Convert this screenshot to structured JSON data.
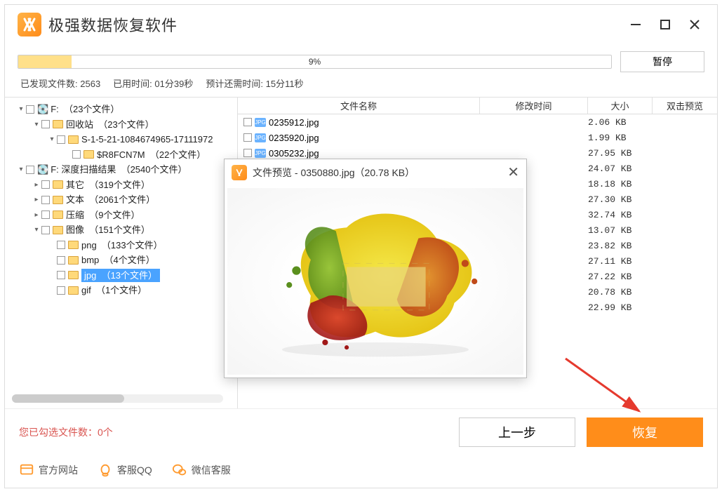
{
  "app_title": "极强数据恢复软件",
  "progress": {
    "percent_text": "9%",
    "percent": 9
  },
  "pause_label": "暂停",
  "status": {
    "found_label_prefix": "已发现文件数:",
    "found_value": "2563",
    "elapsed_label": "已用时间:",
    "elapsed_value": "01分39秒",
    "remaining_label": "预计还需时间:",
    "remaining_value": "15分11秒"
  },
  "tree": [
    {
      "indent": 0,
      "caret": "▾",
      "drive": true,
      "label": "F:",
      "count": "（23个文件）"
    },
    {
      "indent": 1,
      "caret": "▾",
      "drive": false,
      "label": "回收站",
      "count": "（23个文件）"
    },
    {
      "indent": 2,
      "caret": "▾",
      "drive": false,
      "label": "S-1-5-21-1084674965-17111972"
    },
    {
      "indent": 3,
      "caret": "",
      "drive": false,
      "label": "$R8FCN7M",
      "count": "（22个文件）"
    },
    {
      "indent": 0,
      "caret": "▾",
      "drive": true,
      "label": "F: 深度扫描结果",
      "count": "（2540个文件）"
    },
    {
      "indent": 1,
      "caret": "▸",
      "drive": false,
      "label": "其它",
      "count": "（319个文件）"
    },
    {
      "indent": 1,
      "caret": "▸",
      "drive": false,
      "label": "文本",
      "count": "（2061个文件）"
    },
    {
      "indent": 1,
      "caret": "▸",
      "drive": false,
      "label": "压缩",
      "count": "（9个文件）"
    },
    {
      "indent": 1,
      "caret": "▾",
      "drive": false,
      "label": "图像",
      "count": "（151个文件）"
    },
    {
      "indent": 2,
      "caret": "",
      "drive": false,
      "label": "png",
      "count": "（133个文件）"
    },
    {
      "indent": 2,
      "caret": "",
      "drive": false,
      "label": "bmp",
      "count": "（4个文件）"
    },
    {
      "indent": 2,
      "caret": "",
      "drive": false,
      "label": "jpg",
      "count": "（13个文件）",
      "selected": true
    },
    {
      "indent": 2,
      "caret": "",
      "drive": false,
      "label": "gif",
      "count": "（1个文件）"
    }
  ],
  "columns": {
    "name": "文件名称",
    "time": "修改时间",
    "size": "大小",
    "preview": "双击预览"
  },
  "files": [
    {
      "name": "0235912.jpg",
      "size": "2.06 KB",
      "visible": true
    },
    {
      "name": "0235920.jpg",
      "size": "1.99 KB",
      "visible": true
    },
    {
      "name": "0305232.jpg",
      "size": "27.95 KB",
      "visible": false
    },
    {
      "name": "",
      "size": "24.07 KB"
    },
    {
      "name": "",
      "size": "18.18 KB"
    },
    {
      "name": "",
      "size": "27.30 KB"
    },
    {
      "name": "",
      "size": "32.74 KB"
    },
    {
      "name": "",
      "size": "13.07 KB"
    },
    {
      "name": "",
      "size": "23.82 KB"
    },
    {
      "name": "",
      "size": "27.11 KB"
    },
    {
      "name": "",
      "size": "27.22 KB"
    },
    {
      "name": "",
      "size": "20.78 KB"
    },
    {
      "name": "",
      "size": "22.99 KB"
    }
  ],
  "preview": {
    "title_prefix": "文件预览 - ",
    "filename": "0350880.jpg",
    "size_text": "（20.78 KB）"
  },
  "selected_label": "您已勾选文件数：",
  "selected_value": "0个",
  "btn_prev": "上一步",
  "btn_recover": "恢复",
  "links": {
    "website": "官方网站",
    "qq": "客服QQ",
    "wechat": "微信客服"
  }
}
